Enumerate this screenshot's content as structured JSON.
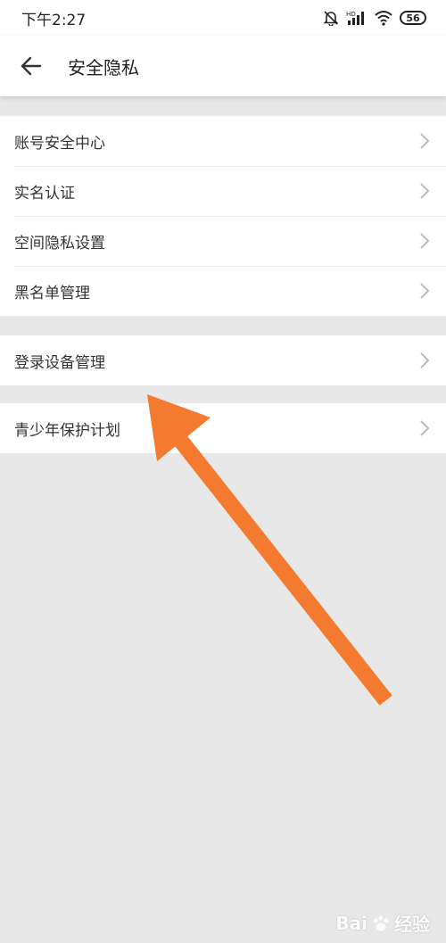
{
  "status_bar": {
    "time": "下午2:27",
    "battery": "56",
    "icons": [
      "mute-alarm-icon",
      "hd-signal-icon",
      "wifi-icon",
      "battery-icon"
    ]
  },
  "header": {
    "title": "安全隐私",
    "back_icon": "back-arrow-icon"
  },
  "groups": [
    {
      "items": [
        {
          "label": "账号安全中心"
        },
        {
          "label": "实名认证"
        },
        {
          "label": "空间隐私设置"
        },
        {
          "label": "黑名单管理"
        }
      ]
    },
    {
      "items": [
        {
          "label": "登录设备管理"
        }
      ]
    },
    {
      "items": [
        {
          "label": "青少年保护计划"
        }
      ]
    }
  ],
  "overlay": {
    "arrow_color": "#f47a30"
  },
  "watermark": {
    "logo_text": "Bai",
    "suffix_text": "经验"
  },
  "colors": {
    "background": "#e8e8e8",
    "surface": "#ffffff",
    "chevron": "#b5b5b5"
  }
}
